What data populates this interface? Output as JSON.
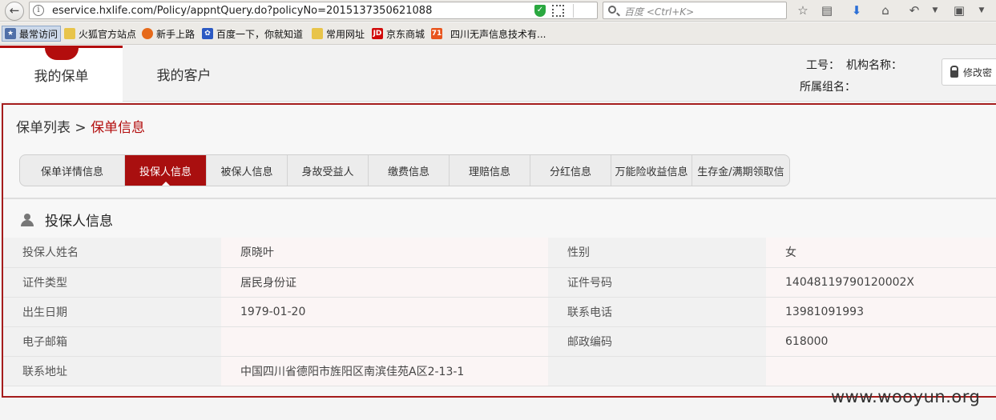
{
  "browser": {
    "url": "eservice.hxlife.com/Policy/appntQuery.do?policyNo=2015137350621088",
    "search_placeholder": "百度 <Ctrl+K>",
    "bookmarks": [
      {
        "label": "最常访问",
        "icon": "star-icon"
      },
      {
        "label": "火狐官方站点",
        "icon": "folder-icon"
      },
      {
        "label": "新手上路",
        "icon": "firefox-icon"
      },
      {
        "label": "百度一下，你就知道",
        "icon": "baidu-icon"
      },
      {
        "label": "常用网址",
        "icon": "folder-icon"
      },
      {
        "label": "京东商城",
        "icon": "jd-icon"
      },
      {
        "label": "四川无声信息技术有...",
        "icon": "site-icon"
      }
    ]
  },
  "header": {
    "tabs": [
      {
        "label": "我的保单",
        "active": true
      },
      {
        "label": "我的客户",
        "active": false
      }
    ],
    "staff_no_label": "工号：",
    "org_name_label": "机构名称：",
    "group_label": "所属组名：",
    "modify_label": "修改密"
  },
  "breadcrumb": {
    "parent": "保单列表",
    "separator": ">",
    "current": "保单信息"
  },
  "subtabs": [
    {
      "label": "保单详情信息",
      "active": false
    },
    {
      "label": "投保人信息",
      "active": true
    },
    {
      "label": "被保人信息",
      "active": false
    },
    {
      "label": "身故受益人",
      "active": false
    },
    {
      "label": "缴费信息",
      "active": false
    },
    {
      "label": "理赔信息",
      "active": false
    },
    {
      "label": "分红信息",
      "active": false
    },
    {
      "label": "万能险收益信息",
      "active": false
    },
    {
      "label": "生存金/满期领取信",
      "active": false
    }
  ],
  "section_title": "投保人信息",
  "applicant": {
    "rows": [
      {
        "label1": "投保人姓名",
        "value1": "原晓叶",
        "label2": "性别",
        "value2": "女"
      },
      {
        "label1": "证件类型",
        "value1": "居民身份证",
        "label2": "证件号码",
        "value2": "14048119790120002X"
      },
      {
        "label1": "出生日期",
        "value1": "1979-01-20",
        "label2": "联系电话",
        "value2": "13981091993"
      },
      {
        "label1": "电子邮箱",
        "value1": "",
        "label2": "邮政编码",
        "value2": "618000"
      },
      {
        "label1": "联系地址",
        "value1": "中国四川省德阳市旌阳区南滨佳苑A区2-13-1",
        "label2": "",
        "value2": ""
      }
    ]
  },
  "watermark": "www.wooyun.org",
  "colors": {
    "accent": "#a90f0f",
    "panel_border": "#a51c1c"
  }
}
